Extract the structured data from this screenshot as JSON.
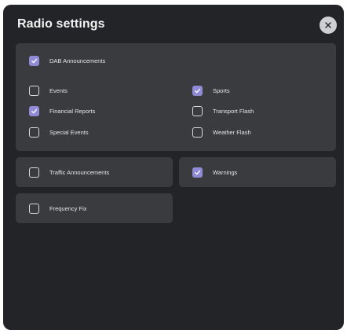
{
  "dialog": {
    "title": "Radio settings",
    "close_icon": "close-icon"
  },
  "dab": {
    "label": "DAB Announcements",
    "checked": true,
    "options": [
      {
        "label": "Events",
        "checked": false
      },
      {
        "label": "Financial Reports",
        "checked": true
      },
      {
        "label": "Special Events",
        "checked": false
      },
      {
        "label": "Sports",
        "checked": true
      },
      {
        "label": "Transport Flash",
        "checked": false
      },
      {
        "label": "Weather Flash",
        "checked": false
      }
    ]
  },
  "traffic": {
    "label": "Traffic Announcements",
    "checked": false
  },
  "warnings": {
    "label": "Warnings",
    "checked": true
  },
  "frequency_fix": {
    "label": "Frequency Fix",
    "checked": false
  },
  "colors": {
    "background": "#232427",
    "card": "#3a3b3f",
    "accent": "#8f8bd6"
  }
}
